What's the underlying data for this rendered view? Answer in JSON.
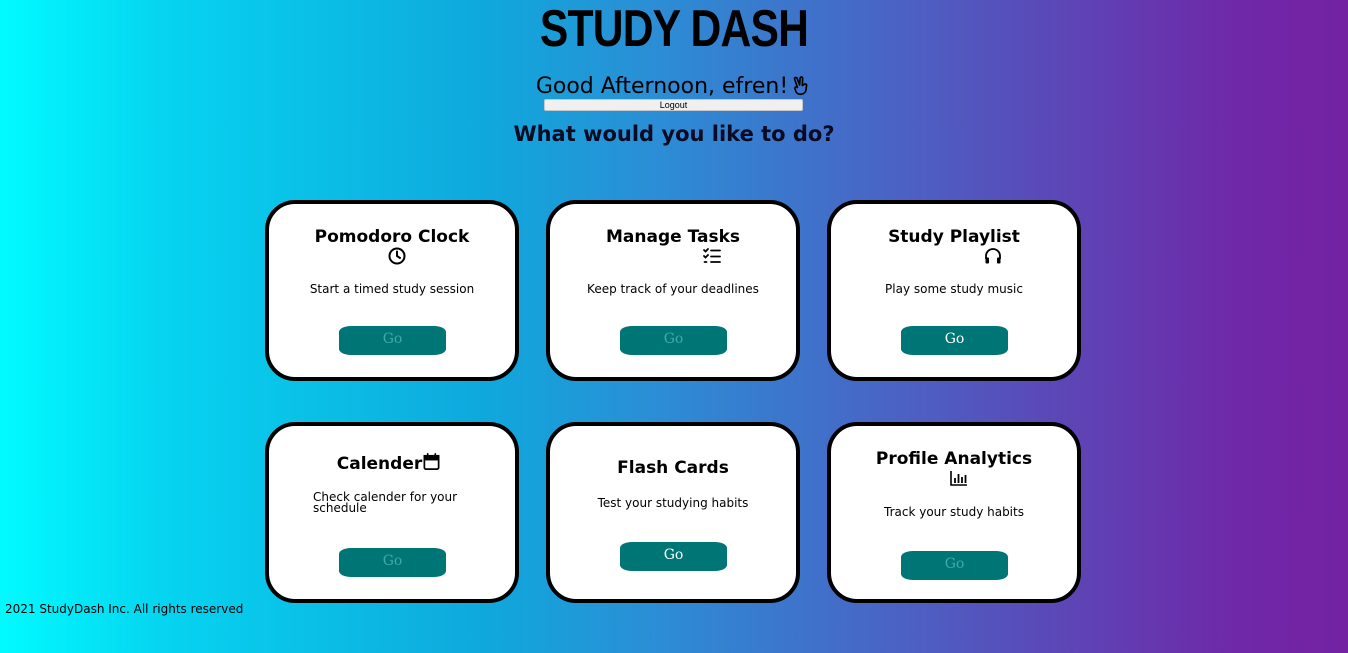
{
  "app": {
    "title": "STUDY DASH",
    "greeting": "Good Afternoon, efren!",
    "greeting_icon": "peace-hand-icon",
    "logout_label": "Logout",
    "question": "What would you like to do?"
  },
  "cards": [
    {
      "title": "Pomodoro Clock",
      "icon": "clock-icon",
      "description": "Start a timed study session",
      "button_label": "Go"
    },
    {
      "title": "Manage Tasks",
      "icon": "task-list-icon",
      "description": "Keep track of your deadlines",
      "button_label": "Go"
    },
    {
      "title": "Study Playlist",
      "icon": "headphones-icon",
      "description": "Play some study music",
      "button_label": "Go"
    },
    {
      "title": "Calender",
      "icon": "calendar-icon",
      "description": "Check calender for your schedule",
      "button_label": "Go"
    },
    {
      "title": "Flash Cards",
      "icon": "",
      "description": "Test your studying habits",
      "button_label": "Go"
    },
    {
      "title": "Profile Analytics",
      "icon": "bar-chart-icon",
      "description": "Track your study habits",
      "button_label": "Go"
    }
  ],
  "footer": {
    "text": "2021 StudyDash Inc. All rights reserved"
  },
  "colors": {
    "button": "#007575",
    "gradient_start": "#00fbff",
    "gradient_end": "#7322a2"
  }
}
